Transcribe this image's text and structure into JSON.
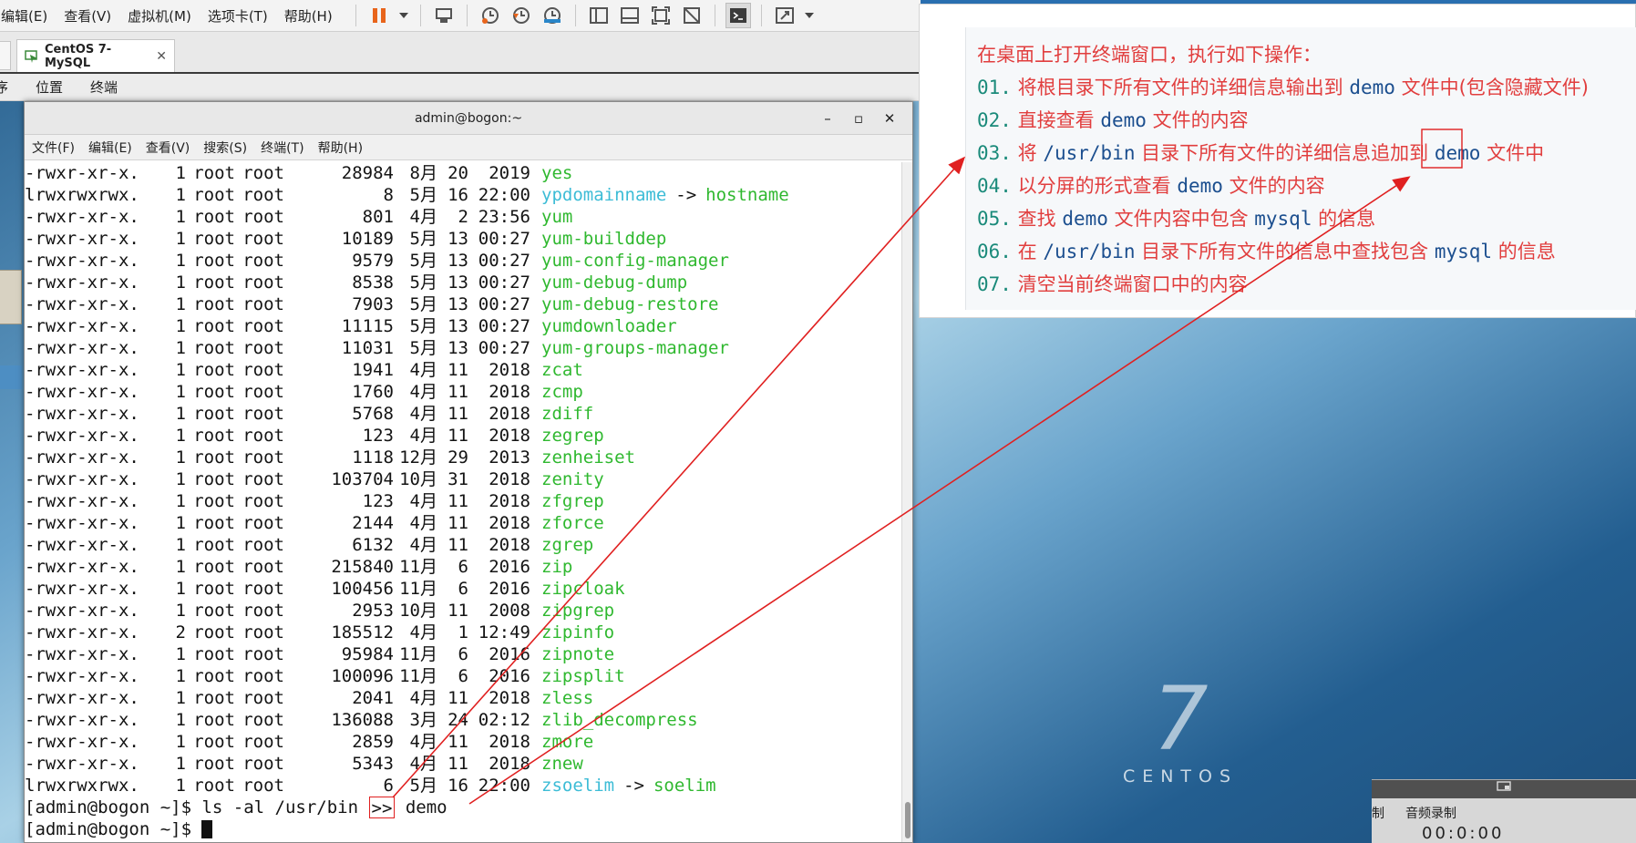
{
  "vm_menubar": {
    "items": [
      "编辑(E)",
      "查看(V)",
      "虚拟机(M)",
      "选项卡(T)",
      "帮助(H)"
    ]
  },
  "vm_tab": {
    "title": "CentOS 7-MySQL",
    "close": "✕"
  },
  "gnome_topbar": {
    "apps_cut": "序",
    "places": "位置",
    "terminal": "终端"
  },
  "terminal": {
    "title": "admin@bogon:~",
    "controls": [
      "–",
      "▫",
      "✕"
    ],
    "menu": [
      "文件(F)",
      "编辑(E)",
      "查看(V)",
      "搜索(S)",
      "终端(T)",
      "帮助(H)"
    ],
    "rows": [
      {
        "perm": "-rwxr-xr-x.",
        "links": "1",
        "owner": "root",
        "group": "root",
        "size": "28984",
        "month": "8月",
        "day": "20",
        "time": "2019",
        "name": "yes"
      },
      {
        "perm": "lrwxrwxrwx.",
        "links": "1",
        "owner": "root",
        "group": "root",
        "size": "8",
        "month": "5月",
        "day": "16",
        "time": "22:00",
        "name": "ypdomainname",
        "target": "hostname"
      },
      {
        "perm": "-rwxr-xr-x.",
        "links": "1",
        "owner": "root",
        "group": "root",
        "size": "801",
        "month": "4月",
        "day": "2",
        "time": "23:56",
        "name": "yum"
      },
      {
        "perm": "-rwxr-xr-x.",
        "links": "1",
        "owner": "root",
        "group": "root",
        "size": "10189",
        "month": "5月",
        "day": "13",
        "time": "00:27",
        "name": "yum-builddep"
      },
      {
        "perm": "-rwxr-xr-x.",
        "links": "1",
        "owner": "root",
        "group": "root",
        "size": "9579",
        "month": "5月",
        "day": "13",
        "time": "00:27",
        "name": "yum-config-manager"
      },
      {
        "perm": "-rwxr-xr-x.",
        "links": "1",
        "owner": "root",
        "group": "root",
        "size": "8538",
        "month": "5月",
        "day": "13",
        "time": "00:27",
        "name": "yum-debug-dump"
      },
      {
        "perm": "-rwxr-xr-x.",
        "links": "1",
        "owner": "root",
        "group": "root",
        "size": "7903",
        "month": "5月",
        "day": "13",
        "time": "00:27",
        "name": "yum-debug-restore"
      },
      {
        "perm": "-rwxr-xr-x.",
        "links": "1",
        "owner": "root",
        "group": "root",
        "size": "11115",
        "month": "5月",
        "day": "13",
        "time": "00:27",
        "name": "yumdownloader"
      },
      {
        "perm": "-rwxr-xr-x.",
        "links": "1",
        "owner": "root",
        "group": "root",
        "size": "11031",
        "month": "5月",
        "day": "13",
        "time": "00:27",
        "name": "yum-groups-manager"
      },
      {
        "perm": "-rwxr-xr-x.",
        "links": "1",
        "owner": "root",
        "group": "root",
        "size": "1941",
        "month": "4月",
        "day": "11",
        "time": "2018",
        "name": "zcat"
      },
      {
        "perm": "-rwxr-xr-x.",
        "links": "1",
        "owner": "root",
        "group": "root",
        "size": "1760",
        "month": "4月",
        "day": "11",
        "time": "2018",
        "name": "zcmp"
      },
      {
        "perm": "-rwxr-xr-x.",
        "links": "1",
        "owner": "root",
        "group": "root",
        "size": "5768",
        "month": "4月",
        "day": "11",
        "time": "2018",
        "name": "zdiff"
      },
      {
        "perm": "-rwxr-xr-x.",
        "links": "1",
        "owner": "root",
        "group": "root",
        "size": "123",
        "month": "4月",
        "day": "11",
        "time": "2018",
        "name": "zegrep"
      },
      {
        "perm": "-rwxr-xr-x.",
        "links": "1",
        "owner": "root",
        "group": "root",
        "size": "1118",
        "month": "12月",
        "day": "29",
        "time": "2013",
        "name": "zenheiset"
      },
      {
        "perm": "-rwxr-xr-x.",
        "links": "1",
        "owner": "root",
        "group": "root",
        "size": "103704",
        "month": "10月",
        "day": "31",
        "time": "2018",
        "name": "zenity"
      },
      {
        "perm": "-rwxr-xr-x.",
        "links": "1",
        "owner": "root",
        "group": "root",
        "size": "123",
        "month": "4月",
        "day": "11",
        "time": "2018",
        "name": "zfgrep"
      },
      {
        "perm": "-rwxr-xr-x.",
        "links": "1",
        "owner": "root",
        "group": "root",
        "size": "2144",
        "month": "4月",
        "day": "11",
        "time": "2018",
        "name": "zforce"
      },
      {
        "perm": "-rwxr-xr-x.",
        "links": "1",
        "owner": "root",
        "group": "root",
        "size": "6132",
        "month": "4月",
        "day": "11",
        "time": "2018",
        "name": "zgrep"
      },
      {
        "perm": "-rwxr-xr-x.",
        "links": "1",
        "owner": "root",
        "group": "root",
        "size": "215840",
        "month": "11月",
        "day": "6",
        "time": "2016",
        "name": "zip"
      },
      {
        "perm": "-rwxr-xr-x.",
        "links": "1",
        "owner": "root",
        "group": "root",
        "size": "100456",
        "month": "11月",
        "day": "6",
        "time": "2016",
        "name": "zipcloak"
      },
      {
        "perm": "-rwxr-xr-x.",
        "links": "1",
        "owner": "root",
        "group": "root",
        "size": "2953",
        "month": "10月",
        "day": "11",
        "time": "2008",
        "name": "zipgrep"
      },
      {
        "perm": "-rwxr-xr-x.",
        "links": "2",
        "owner": "root",
        "group": "root",
        "size": "185512",
        "month": "4月",
        "day": "1",
        "time": "12:49",
        "name": "zipinfo"
      },
      {
        "perm": "-rwxr-xr-x.",
        "links": "1",
        "owner": "root",
        "group": "root",
        "size": "95984",
        "month": "11月",
        "day": "6",
        "time": "2016",
        "name": "zipnote"
      },
      {
        "perm": "-rwxr-xr-x.",
        "links": "1",
        "owner": "root",
        "group": "root",
        "size": "100096",
        "month": "11月",
        "day": "6",
        "time": "2016",
        "name": "zipsplit"
      },
      {
        "perm": "-rwxr-xr-x.",
        "links": "1",
        "owner": "root",
        "group": "root",
        "size": "2041",
        "month": "4月",
        "day": "11",
        "time": "2018",
        "name": "zless"
      },
      {
        "perm": "-rwxr-xr-x.",
        "links": "1",
        "owner": "root",
        "group": "root",
        "size": "136088",
        "month": "3月",
        "day": "24",
        "time": "02:12",
        "name": "zlib_decompress"
      },
      {
        "perm": "-rwxr-xr-x.",
        "links": "1",
        "owner": "root",
        "group": "root",
        "size": "2859",
        "month": "4月",
        "day": "11",
        "time": "2018",
        "name": "zmore"
      },
      {
        "perm": "-rwxr-xr-x.",
        "links": "1",
        "owner": "root",
        "group": "root",
        "size": "5343",
        "month": "4月",
        "day": "11",
        "time": "2018",
        "name": "znew"
      },
      {
        "perm": "lrwxrwxrwx.",
        "links": "1",
        "owner": "root",
        "group": "root",
        "size": "6",
        "month": "5月",
        "day": "16",
        "time": "22:00",
        "name": "zsoelim",
        "target": "soelim"
      }
    ],
    "arrow_sym": "->",
    "prompt1": {
      "prompt": "[admin@bogon ~]$ ",
      "cmd_before": "ls -al /usr/bin ",
      "cmd_highlight": ">>",
      "cmd_after": " demo"
    },
    "prompt2": {
      "prompt": "[admin@bogon ~]$ "
    }
  },
  "desktop": {
    "version": "7",
    "brand": "CENTOS"
  },
  "bottom_panel": {
    "tab1": "制",
    "tab2": "音频录制",
    "clock": "00:0:00"
  },
  "notes": {
    "intro": "在桌面上打开终端窗口，执行如下操作：",
    "items": [
      {
        "num": "01.",
        "parts": [
          [
            "t",
            "将根目录下所有文件的详细信息输出到 "
          ],
          [
            "c",
            "demo"
          ],
          [
            "t",
            " 文件中(包含隐藏文件)"
          ]
        ]
      },
      {
        "num": "02.",
        "parts": [
          [
            "t",
            "直接查看 "
          ],
          [
            "c",
            "demo"
          ],
          [
            "t",
            " 文件的内容"
          ]
        ]
      },
      {
        "num": "03.",
        "parts": [
          [
            "t",
            "将 "
          ],
          [
            "c",
            "/usr/bin"
          ],
          [
            "t",
            " 目录下所有文件的详细信息"
          ],
          [
            "h",
            "追加"
          ],
          [
            "t",
            "到 "
          ],
          [
            "c",
            "demo"
          ],
          [
            "t",
            " 文件中"
          ]
        ]
      },
      {
        "num": "04.",
        "parts": [
          [
            "t",
            "以分屏的形式查看 "
          ],
          [
            "c",
            "demo"
          ],
          [
            "t",
            " 文件的内容"
          ]
        ]
      },
      {
        "num": "05.",
        "parts": [
          [
            "t",
            "查找 "
          ],
          [
            "c",
            "demo"
          ],
          [
            "t",
            " 文件内容中包含 "
          ],
          [
            "c",
            "mysql"
          ],
          [
            "t",
            " 的信息"
          ]
        ]
      },
      {
        "num": "06.",
        "parts": [
          [
            "t",
            "在 "
          ],
          [
            "c",
            "/usr/bin"
          ],
          [
            "t",
            " 目录下所有文件的信息中查找包含 "
          ],
          [
            "c",
            "mysql"
          ],
          [
            "t",
            " 的信息"
          ]
        ]
      },
      {
        "num": "07.",
        "parts": [
          [
            "t",
            "清空当前终端窗口中的内容"
          ]
        ]
      }
    ]
  },
  "colors": {
    "annotation_red": "#e02020",
    "ls_green": "#2fb82f",
    "ls_cyan": "#3cbcd6",
    "code_blue": "#1c4f8f",
    "num_teal": "#1a8a7a"
  }
}
